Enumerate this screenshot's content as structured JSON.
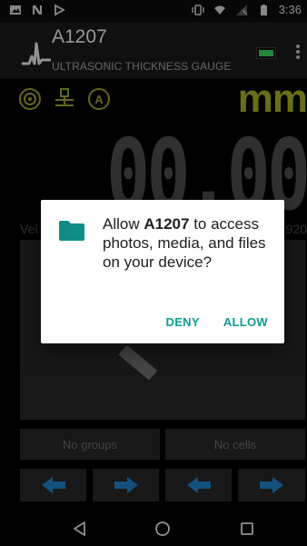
{
  "status_bar": {
    "time": "3:36",
    "left_icons": [
      "photo-icon",
      "n-icon",
      "play-icon"
    ],
    "right_icons": [
      "vibrate-icon",
      "wifi-icon",
      "no-signal-icon",
      "battery-icon"
    ]
  },
  "app_bar": {
    "title": "A1207",
    "subtitle": "ULTRASONIC THICKNESS GAUGE",
    "battery_color": "#39d05c",
    "menu_icon": "kebab-menu-icon"
  },
  "mode": {
    "icons": [
      "target-icon",
      "transducer-icon",
      "auto-mode-icon"
    ],
    "unit": "mm",
    "unit_color": "#a2ab23"
  },
  "reading": {
    "value": "00.00"
  },
  "velocity": {
    "label_left": "Vel",
    "value_right": "920"
  },
  "groups": {
    "groups_label": "No groups",
    "cells_label": "No cells"
  },
  "nav_arrows": [
    "arrow-left-icon",
    "arrow-right-icon",
    "arrow-left-icon",
    "arrow-right-icon"
  ],
  "arrow_color": "#1f7fc0",
  "dialog": {
    "icon": "folder-icon",
    "message_prefix": "Allow ",
    "app_name": "A1207",
    "message_suffix": " to access photos, media, and files on your device?",
    "deny_label": "DENY",
    "allow_label": "ALLOW",
    "accent_color": "#0f9a92"
  },
  "nav_bar": {
    "back": "back-icon",
    "home": "home-icon",
    "recent": "recents-icon"
  }
}
